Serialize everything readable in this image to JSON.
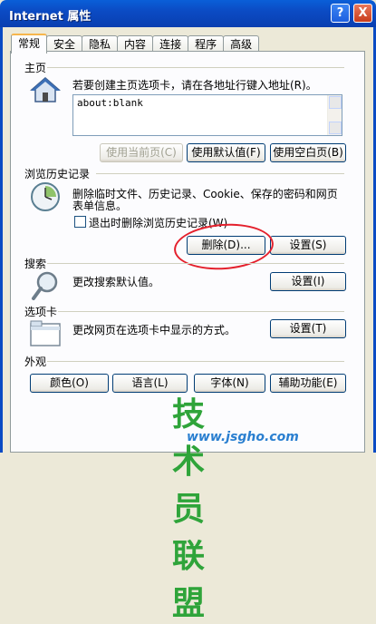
{
  "window": {
    "title": "Internet 属性",
    "help_label": "?",
    "close_label": "X"
  },
  "tabs": [
    {
      "label": "常规",
      "active": true
    },
    {
      "label": "安全"
    },
    {
      "label": "隐私"
    },
    {
      "label": "内容"
    },
    {
      "label": "连接"
    },
    {
      "label": "程序"
    },
    {
      "label": "高级"
    }
  ],
  "home": {
    "section_label": "主页",
    "description": "若要创建主页选项卡，请在各地址行键入地址(R)。",
    "address_value": "about:blank",
    "buttons": {
      "use_current": "使用当前页(C)",
      "use_default": "使用默认值(F)",
      "use_blank": "使用空白页(B)"
    }
  },
  "history": {
    "section_label": "浏览历史记录",
    "description_line1": "删除临时文件、历史记录、Cookie、保存的密码和网页",
    "description_line2": "表单信息。",
    "checkbox_label": "退出时删除浏览历史记录(W)",
    "checkbox_checked": false,
    "delete_button": "删除(D)...",
    "settings_button": "设置(S)"
  },
  "search": {
    "section_label": "搜索",
    "description": "更改搜索默认值。",
    "settings_button": "设置(I)"
  },
  "tabs_section": {
    "section_label": "选项卡",
    "description": "更改网页在选项卡中显示的方式。",
    "settings_button": "设置(T)"
  },
  "appearance": {
    "section_label": "外观",
    "buttons": {
      "colors": "颜色(O)",
      "languages": "语言(L)",
      "fonts": "字体(N)",
      "accessibility": "辅助功能(E)"
    }
  },
  "watermark": {
    "main": "技术员联盟",
    "url": "www.jsgho.com"
  },
  "colors": {
    "titlebar": "#0a4bc4",
    "highlight_ellipse": "#e4202c",
    "watermark_green": "#2fa43a"
  }
}
